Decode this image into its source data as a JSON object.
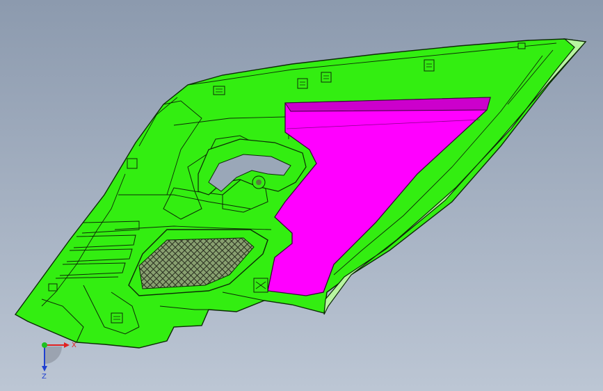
{
  "viewport": {
    "background_top": "#8c9aae",
    "background_bottom": "#bcc6d4"
  },
  "model": {
    "body_color": "#33ee11",
    "edge_color": "#0c2a06",
    "highlight_color": "#b8f5a0",
    "face_color": "#ff00ff",
    "mesh_color": "#7a8a70"
  },
  "triad": {
    "x_label": "X",
    "z_label": "Z",
    "x_color": "#e02020",
    "y_color": "#20c020",
    "z_color": "#2040d0"
  }
}
